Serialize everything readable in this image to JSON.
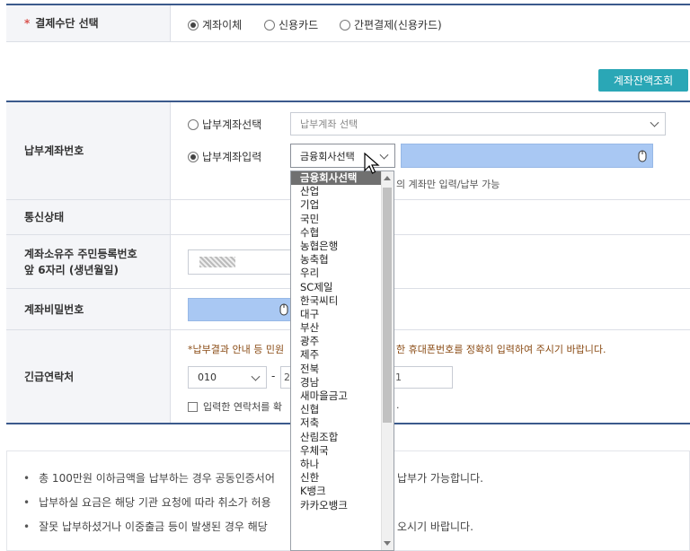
{
  "payment": {
    "label": "결제수단 선택",
    "options": [
      "계좌이체",
      "신용카드",
      "간편결제(신용카드)"
    ],
    "selected": 0
  },
  "balance_button": "계좌잔액조회",
  "account": {
    "label": "납부계좌번호",
    "opt_select": "납부계좌선택",
    "opt_input": "납부계좌입력",
    "select_placeholder": "납부계좌 선택",
    "bank_select_value": "금융회사선택",
    "hint": "의 계좌만 입력/납부 가능"
  },
  "comm": {
    "label": "통신상태"
  },
  "owner": {
    "label_line1": "계좌소유주 주민등록번호",
    "label_line2": "앞 6자리 (생년월일)"
  },
  "password": {
    "label": "계좌비밀번호"
  },
  "emergency": {
    "label": "긴급연락처",
    "notice_left": "*납부결과 안내 등 민원",
    "notice_right": "한 휴대폰번호를 정확히 입력하여 주시기 바랍니다.",
    "phone1": "010",
    "phone2": "2",
    "phone3": "1",
    "sep": "-",
    "confirm_left": "입력한 연락처를 확",
    "confirm_right": "."
  },
  "notes": [
    {
      "left": "총 100만원 이하금액을 납부하는 경우 공동인증서어",
      "right": "납부가 가능합니다."
    },
    {
      "left": "납부하실 요금은 해당 기관 요청에 따라 취소가 허용",
      "right": ""
    },
    {
      "left": "잘못 납부하셨거나 이중출금 등이 발생된 경우 해당",
      "right": "오시기 바랍니다."
    }
  ],
  "banks": [
    "금융회사선택",
    "산업",
    "기업",
    "국민",
    "수협",
    "농협은행",
    "농축협",
    "우리",
    "SC제일",
    "한국씨티",
    "대구",
    "부산",
    "광주",
    "제주",
    "전북",
    "경남",
    "새마을금고",
    "신협",
    "저축",
    "산림조합",
    "우체국",
    "하나",
    "신한",
    "K뱅크",
    "카카오뱅크"
  ],
  "colors": {
    "accent": "#2aa7b6",
    "blue_field": "#a9c8f3",
    "header_line": "#3b5a8c",
    "required": "#d9534f",
    "notice": "#8a4b14"
  }
}
